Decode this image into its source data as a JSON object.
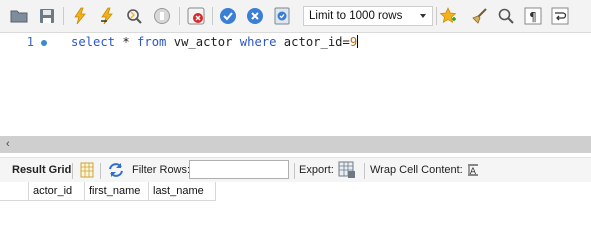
{
  "toolbar": {
    "icons": [
      "open-folder-icon",
      "save-icon",
      "execute-lightning-icon",
      "execute-cursor-lightning-icon",
      "explain-magnifier-icon",
      "stop-icon",
      "toggle-continue-on-error-icon",
      "commit-icon",
      "rollback-icon",
      "toggle-autocommit-icon",
      "add-snippet-star-icon",
      "beautify-broom-icon",
      "find-icon",
      "invisible-chars-icon",
      "wrap-lines-icon"
    ],
    "limit_select": "Limit to 1000 rows"
  },
  "editor": {
    "line_number": "1",
    "tokens": {
      "t1": "select",
      "t2": " * ",
      "t3": "from",
      "t4": " vw_actor ",
      "t5": "where",
      "t6": " actor_id=",
      "t7": "9"
    }
  },
  "result_bar": {
    "result_grid_label": "Result Grid",
    "filter_rows_label": "Filter Rows:",
    "filter_value": "",
    "export_label": "Export:",
    "wrap_cell_label": "Wrap Cell Content:"
  },
  "grid": {
    "columns": [
      "actor_id",
      "first_name",
      "last_name"
    ]
  },
  "colors": {
    "keyword": "#2a56c9",
    "number": "#c66a00",
    "line_number": "#3d64c9"
  }
}
